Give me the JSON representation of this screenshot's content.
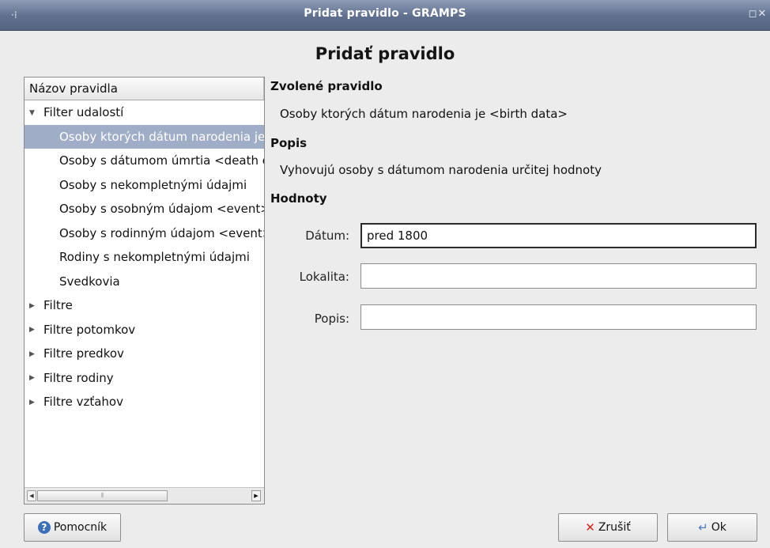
{
  "window": {
    "title": "Pridat pravidlo - GRAMPS",
    "controls": [
      "◻",
      "✕"
    ]
  },
  "dialog": {
    "heading": "Pridať pravidlo"
  },
  "tree": {
    "header": "Názov pravidla",
    "rows": [
      {
        "label": "Filter udalostí",
        "level": 0,
        "expander": "expanded"
      },
      {
        "label": "Osoby ktorých dátum narodenia je <birth data>",
        "level": 1,
        "selected": true
      },
      {
        "label": "Osoby s dátumom úmrtia <death data>",
        "level": 1
      },
      {
        "label": "Osoby s nekompletnými údajmi",
        "level": 1
      },
      {
        "label": "Osoby s osobným údajom <event>",
        "level": 1
      },
      {
        "label": "Osoby s rodinným údajom <event>",
        "level": 1
      },
      {
        "label": "Rodiny s nekompletnými údajmi",
        "level": 1
      },
      {
        "label": "Svedkovia",
        "level": 1
      },
      {
        "label": "Filtre",
        "level": 0,
        "expander": "collapsed"
      },
      {
        "label": "Filtre potomkov",
        "level": 0,
        "expander": "collapsed"
      },
      {
        "label": "Filtre predkov",
        "level": 0,
        "expander": "collapsed"
      },
      {
        "label": "Filtre rodiny",
        "level": 0,
        "expander": "collapsed"
      },
      {
        "label": "Filtre vzťahov",
        "level": 0,
        "expander": "collapsed"
      }
    ]
  },
  "details": {
    "selected_rule_label": "Zvolené pravidlo",
    "selected_rule_text": "Osoby ktorých dátum narodenia je <birth data>",
    "description_label": "Popis",
    "description_text": "Vyhovujú osoby s dátumom narodenia určitej hodnoty",
    "values_label": "Hodnoty",
    "fields": [
      {
        "label": "Dátum:",
        "value": "pred 1800"
      },
      {
        "label": "Lokalita:",
        "value": ""
      },
      {
        "label": "Popis:",
        "value": ""
      }
    ]
  },
  "buttons": {
    "help": "Pomocník",
    "cancel": "Zrušiť",
    "ok": "Ok"
  }
}
